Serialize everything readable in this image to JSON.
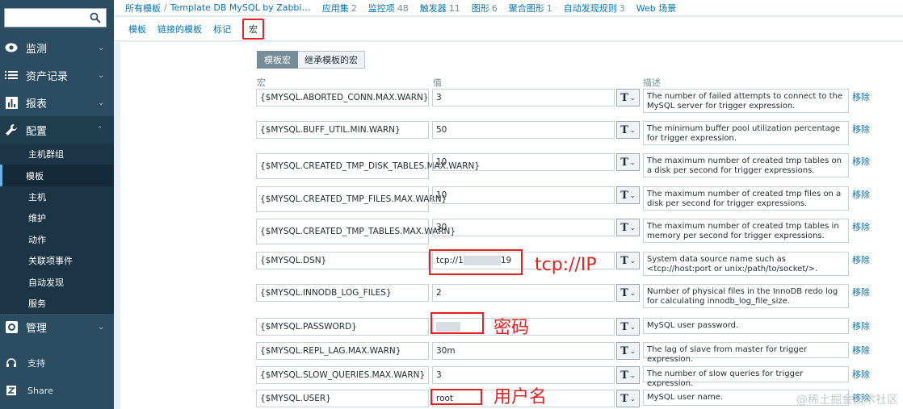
{
  "sidebar": {
    "search": {
      "placeholder": ""
    },
    "items": [
      {
        "label": "监测",
        "icon": "eye-icon"
      },
      {
        "label": "资产记录",
        "icon": "list-icon"
      },
      {
        "label": "报表",
        "icon": "bar-chart-icon"
      },
      {
        "label": "配置",
        "icon": "wrench-icon"
      }
    ],
    "config_sub": [
      "主机群组",
      "模板",
      "主机",
      "维护",
      "动作",
      "关联项事件",
      "自动发现",
      "服务"
    ],
    "admin": {
      "label": "管理",
      "icon": "gear-icon"
    },
    "support": {
      "label": "支持",
      "icon": "headset-icon"
    },
    "share": {
      "label": "Share",
      "icon": "zabbix-share-icon"
    }
  },
  "header": {
    "all_templates": "所有模板",
    "separator": "/",
    "template_name": "Template DB MySQL by Zabbix agen...",
    "tabs": [
      {
        "label": "应用集",
        "count": "2"
      },
      {
        "label": "监控项",
        "count": "48"
      },
      {
        "label": "触发器",
        "count": "11"
      },
      {
        "label": "图形",
        "count": "6"
      },
      {
        "label": "聚合图形",
        "count": "1"
      },
      {
        "label": "自动发现规则",
        "count": "3"
      },
      {
        "label": "Web 场景",
        "count": ""
      }
    ]
  },
  "subtabs": [
    "模板",
    "链接的模板",
    "标记",
    "宏"
  ],
  "macros": {
    "mode_buttons": [
      "模板宏",
      "继承模板的宏"
    ],
    "col_macro": "宏",
    "col_value": "值",
    "col_desc": "描述",
    "remove_label": "移除",
    "rows": [
      {
        "macro": "{$MYSQL.ABORTED_CONN.MAX.WARN}",
        "value": "3",
        "desc": "The number of failed attempts to connect to the MySQL server for trigger expression."
      },
      {
        "macro": "{$MYSQL.BUFF_UTIL.MIN.WARN}",
        "value": "50",
        "desc": "The minimum buffer pool utilization percentage for trigger expression."
      },
      {
        "macro": "{$MYSQL.CREATED_TMP_DISK_TABLES.MAX.WARN}",
        "value": "10",
        "desc": "The maximum number of created tmp tables on a disk per second for trigger expressions."
      },
      {
        "macro": "{$MYSQL.CREATED_TMP_FILES.MAX.WARN}",
        "value": "10",
        "desc": "The maximum number of created tmp files on a disk per second for trigger expressions."
      },
      {
        "macro": "{$MYSQL.CREATED_TMP_TABLES.MAX.WARN}",
        "value": "30",
        "desc": "The maximum number of created tmp tables in memory per second for trigger expressions."
      },
      {
        "macro": "{$MYSQL.DSN}",
        "value": "tcp://1",
        "value_tail": "19",
        "desc": "System data source name such as <tcp://host:port or unix:/path/to/socket/>."
      },
      {
        "macro": "{$MYSQL.INNODB_LOG_FILES}",
        "value": "2",
        "desc": "Number of physical files in the InnoDB redo log for calculating innodb_log_file_size."
      },
      {
        "macro": "{$MYSQL.PASSWORD}",
        "value": "",
        "desc": "MySQL user password."
      },
      {
        "macro": "{$MYSQL.REPL_LAG.MAX.WARN}",
        "value": "30m",
        "desc": "The lag of slave from master for trigger expression."
      },
      {
        "macro": "{$MYSQL.SLOW_QUERIES.MAX.WARN}",
        "value": "3",
        "desc": "The number of slow queries for trigger expression."
      },
      {
        "macro": "{$MYSQL.USER}",
        "value": "root",
        "desc": "MySQL user name."
      }
    ],
    "type_symbol": "T"
  },
  "annotations": {
    "dsn": "tcp://IP",
    "password": "密码",
    "user": "用户名"
  },
  "watermark": "@稀土掘金技术社区",
  "colors": {
    "sidebar_bg": "#2b4c61",
    "link": "#0275b8",
    "highlight": "#e32222"
  }
}
